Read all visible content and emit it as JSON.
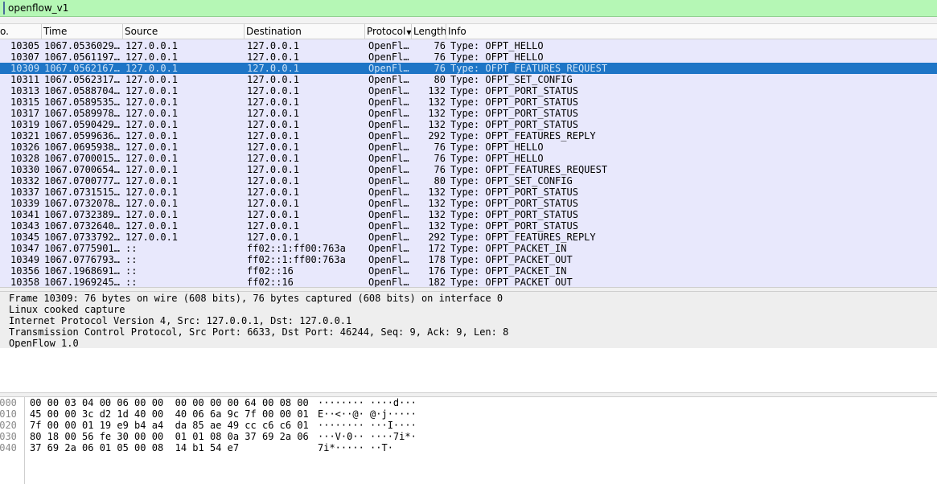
{
  "filter": {
    "value": "openflow_v1"
  },
  "columns": [
    "o.",
    "Time",
    "Source",
    "Destination",
    "Protocol",
    "Length",
    "Info"
  ],
  "packets": [
    [
      "10305",
      "1067.0536029…",
      "127.0.0.1",
      "127.0.0.1",
      "OpenFl…",
      "76",
      "Type: OFPT_HELLO"
    ],
    [
      "10307",
      "1067.0561197…",
      "127.0.0.1",
      "127.0.0.1",
      "OpenFl…",
      "76",
      "Type: OFPT_HELLO"
    ],
    [
      "10309",
      "1067.0562167…",
      "127.0.0.1",
      "127.0.0.1",
      "OpenFl…",
      "76",
      "Type: OFPT_FEATURES_REQUEST"
    ],
    [
      "10311",
      "1067.0562317…",
      "127.0.0.1",
      "127.0.0.1",
      "OpenFl…",
      "80",
      "Type: OFPT_SET_CONFIG"
    ],
    [
      "10313",
      "1067.0588704…",
      "127.0.0.1",
      "127.0.0.1",
      "OpenFl…",
      "132",
      "Type: OFPT_PORT_STATUS"
    ],
    [
      "10315",
      "1067.0589535…",
      "127.0.0.1",
      "127.0.0.1",
      "OpenFl…",
      "132",
      "Type: OFPT_PORT_STATUS"
    ],
    [
      "10317",
      "1067.0589978…",
      "127.0.0.1",
      "127.0.0.1",
      "OpenFl…",
      "132",
      "Type: OFPT_PORT_STATUS"
    ],
    [
      "10319",
      "1067.0590429…",
      "127.0.0.1",
      "127.0.0.1",
      "OpenFl…",
      "132",
      "Type: OFPT_PORT_STATUS"
    ],
    [
      "10321",
      "1067.0599636…",
      "127.0.0.1",
      "127.0.0.1",
      "OpenFl…",
      "292",
      "Type: OFPT_FEATURES_REPLY"
    ],
    [
      "10326",
      "1067.0695938…",
      "127.0.0.1",
      "127.0.0.1",
      "OpenFl…",
      "76",
      "Type: OFPT_HELLO"
    ],
    [
      "10328",
      "1067.0700015…",
      "127.0.0.1",
      "127.0.0.1",
      "OpenFl…",
      "76",
      "Type: OFPT_HELLO"
    ],
    [
      "10330",
      "1067.0700654…",
      "127.0.0.1",
      "127.0.0.1",
      "OpenFl…",
      "76",
      "Type: OFPT_FEATURES_REQUEST"
    ],
    [
      "10332",
      "1067.0700777…",
      "127.0.0.1",
      "127.0.0.1",
      "OpenFl…",
      "80",
      "Type: OFPT_SET_CONFIG"
    ],
    [
      "10337",
      "1067.0731515…",
      "127.0.0.1",
      "127.0.0.1",
      "OpenFl…",
      "132",
      "Type: OFPT_PORT_STATUS"
    ],
    [
      "10339",
      "1067.0732078…",
      "127.0.0.1",
      "127.0.0.1",
      "OpenFl…",
      "132",
      "Type: OFPT_PORT_STATUS"
    ],
    [
      "10341",
      "1067.0732389…",
      "127.0.0.1",
      "127.0.0.1",
      "OpenFl…",
      "132",
      "Type: OFPT_PORT_STATUS"
    ],
    [
      "10343",
      "1067.0732640…",
      "127.0.0.1",
      "127.0.0.1",
      "OpenFl…",
      "132",
      "Type: OFPT_PORT_STATUS"
    ],
    [
      "10345",
      "1067.0733792…",
      "127.0.0.1",
      "127.0.0.1",
      "OpenFl…",
      "292",
      "Type: OFPT_FEATURES_REPLY"
    ],
    [
      "10347",
      "1067.0775901…",
      "::",
      "ff02::1:ff00:763a",
      "OpenFl…",
      "172",
      "Type: OFPT_PACKET_IN"
    ],
    [
      "10349",
      "1067.0776793…",
      "::",
      "ff02::1:ff00:763a",
      "OpenFl…",
      "178",
      "Type: OFPT_PACKET_OUT"
    ],
    [
      "10356",
      "1067.1968691…",
      "::",
      "ff02::16",
      "OpenFl…",
      "176",
      "Type: OFPT_PACKET_IN"
    ],
    [
      "10358",
      "1067.1969245…",
      "::",
      "ff02::16",
      "OpenFl…",
      "182",
      "Type: OFPT_PACKET_OUT"
    ]
  ],
  "selected_no": "10309",
  "details": [
    "Frame 10309: 76 bytes on wire (608 bits), 76 bytes captured (608 bits) on interface 0",
    "Linux cooked capture",
    "Internet Protocol Version 4, Src: 127.0.0.1, Dst: 127.0.0.1",
    "Transmission Control Protocol, Src Port: 6633, Dst Port: 46244, Seq: 9, Ack: 9, Len: 8",
    "OpenFlow 1.0"
  ],
  "bytes": [
    {
      "offset": "0000",
      "hex": "00 00 03 04 00 06 00 00  00 00 00 00 64 00 08 00",
      "ascii": "········ ····d···"
    },
    {
      "offset": "0010",
      "hex": "45 00 00 3c d2 1d 40 00  40 06 6a 9c 7f 00 00 01",
      "ascii": "E··<··@· @·j·····"
    },
    {
      "offset": "0020",
      "hex": "7f 00 00 01 19 e9 b4 a4  da 85 ae 49 cc c6 c6 01",
      "ascii": "········ ···I····"
    },
    {
      "offset": "0030",
      "hex": "80 18 00 56 fe 30 00 00  01 01 08 0a 37 69 2a 06",
      "ascii": "···V·0·· ····7i*·"
    },
    {
      "offset": "0040",
      "hex": "37 69 2a 06 01 05 00 08  14 b1 54 e7",
      "ascii": "7i*····· ··T·"
    }
  ]
}
